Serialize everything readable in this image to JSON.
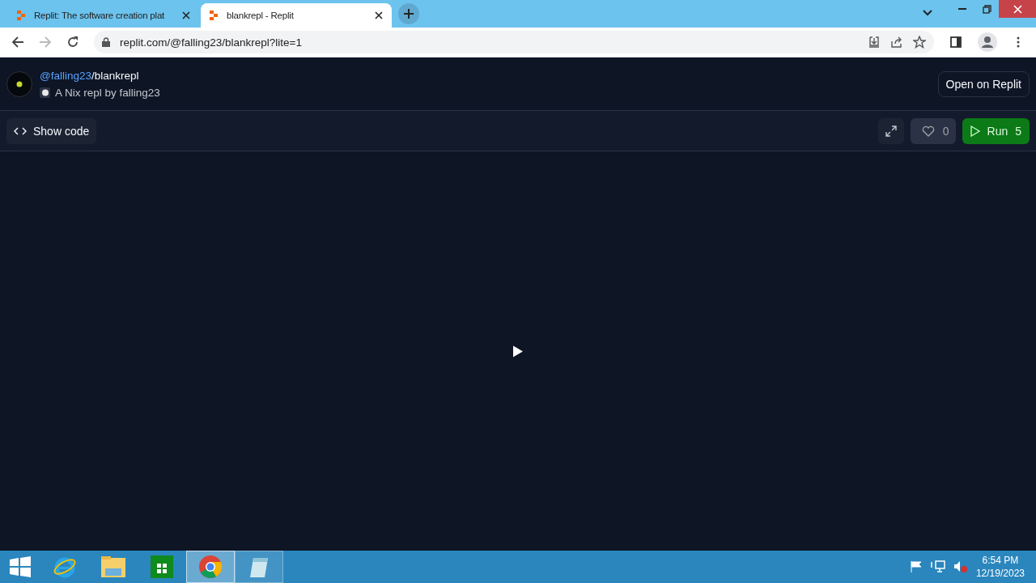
{
  "browser": {
    "tabs": [
      {
        "title": "Replit: The software creation plat",
        "selected": false
      },
      {
        "title": "blankrepl - Replit",
        "selected": true
      }
    ],
    "url": "replit.com/@falling23/blankrepl?lite=1"
  },
  "repl": {
    "owner": "@falling23",
    "separator": "/",
    "name": "blankrepl",
    "description": "A Nix repl by falling23",
    "open_button": "Open on Replit"
  },
  "toolbar": {
    "show_code": "Show code",
    "likes": "0",
    "run_label": "Run",
    "run_count": "5"
  },
  "taskbar": {
    "apps": [
      {
        "kind": "ie",
        "running": false,
        "selected": false
      },
      {
        "kind": "explorer",
        "running": false,
        "selected": false
      },
      {
        "kind": "store",
        "running": false,
        "selected": false
      },
      {
        "kind": "chrome",
        "running": true,
        "selected": true
      },
      {
        "kind": "notepad",
        "running": true,
        "selected": false
      }
    ],
    "time": "6:54 PM",
    "date": "12/19/2023"
  }
}
